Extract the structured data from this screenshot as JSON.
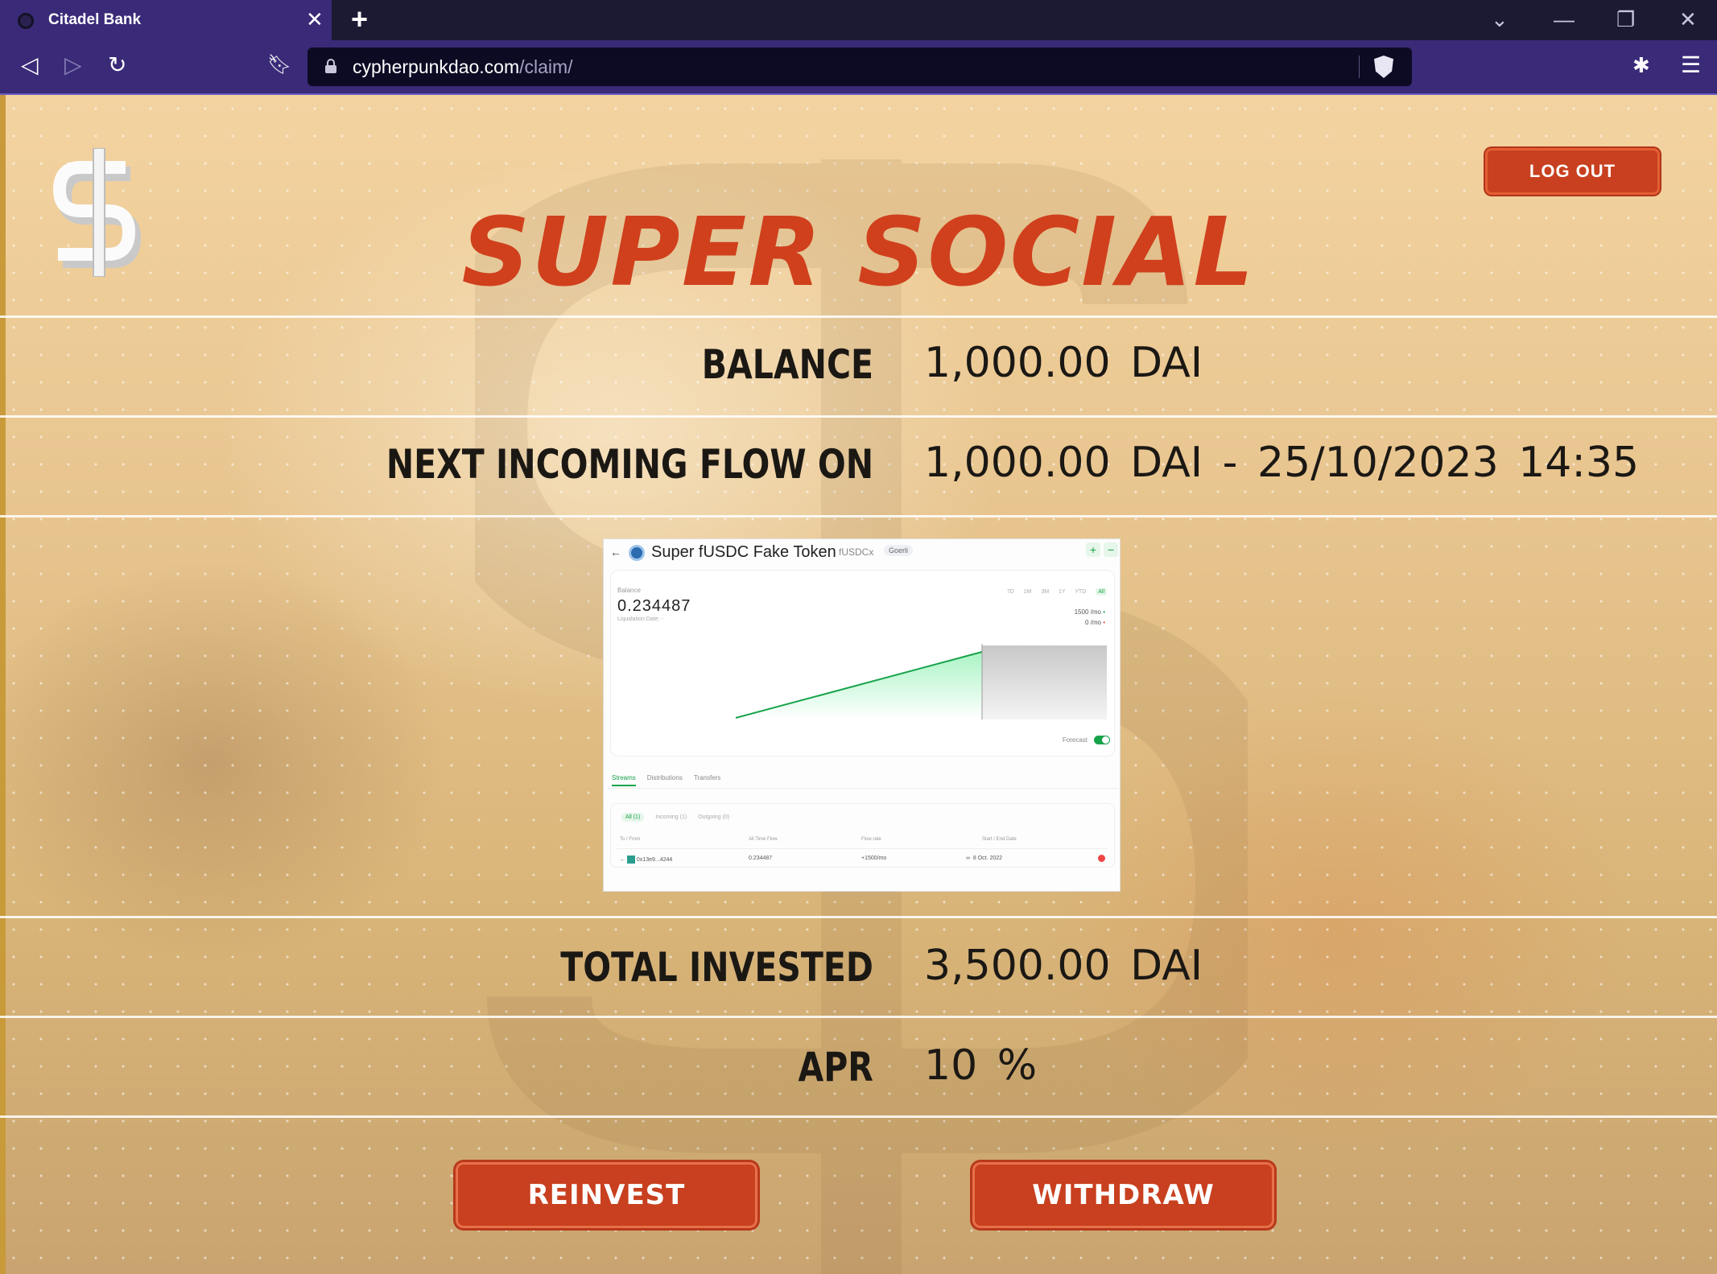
{
  "browser": {
    "tab_title": "Citadel Bank",
    "url_host": "cypherpunkdao.com",
    "url_path": "/claim/"
  },
  "header": {
    "logout_label": "LOG OUT",
    "title": "SUPER SOCIAL"
  },
  "stats": {
    "balance_label": "BALANCE",
    "balance_value": "1,000.00  DAI",
    "next_flow_label": "NEXT INCOMING FLOW ON",
    "next_flow_value": "1,000.00  DAI  -  25/10/2023  14:35",
    "total_invested_label": "TOTAL INVESTED",
    "total_invested_value": "3,500.00  DAI",
    "apr_label": "APR",
    "apr_value": "10 %"
  },
  "embedded_screenshot": {
    "token_name": "Super fUSDC Fake Token",
    "token_symbol": "fUSDCx",
    "network": "Goerli",
    "balance_label": "Balance",
    "balance_value": "0.234487",
    "liquidation_label": "Liquidation Date: -",
    "ranges": [
      "7D",
      "1M",
      "3M",
      "1Y",
      "YTD",
      "All"
    ],
    "rate_in": "1500 /mo",
    "rate_out": "0 /mo",
    "forecast_label": "Forecast",
    "tabs": [
      "Streams",
      "Distributions",
      "Transfers"
    ],
    "filters": [
      "All (1)",
      "Incoming (1)",
      "Outgoing (0)"
    ],
    "columns": [
      "To / From",
      "All Time Flow",
      "Flow rate",
      "Start / End Date"
    ],
    "row": {
      "address": "0x13e9...4244",
      "all_time_flow": "0.234487",
      "flow_rate": "+1500/mo",
      "start_date": "8 Oct. 2022"
    }
  },
  "actions": {
    "reinvest_label": "REINVEST",
    "withdraw_label": "WITHDRAW"
  },
  "colors": {
    "accent": "#c8401f",
    "title": "#d0401d",
    "browser_purple": "#3a2a78"
  }
}
